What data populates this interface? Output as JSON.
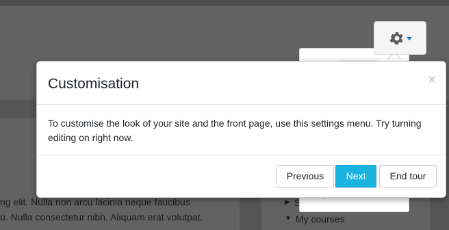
{
  "background": {
    "paragraph_line_1": "ng elit. Nulla non arcu lacinia neque faucibus",
    "paragraph_line_2": "u. Nulla consectetur nibh. Aliquam erat volutpat.",
    "nav_items": [
      {
        "label": "S"
      },
      {
        "label": "My courses"
      }
    ]
  },
  "settings_menu": {
    "icon": "gear-icon",
    "visible_item": "More..."
  },
  "tour": {
    "title": "Customisation",
    "body": "To customise the look of your site and the front page, use this settings menu. Try turning editing on right now.",
    "close_symbol": "×",
    "buttons": {
      "previous": "Previous",
      "next": "Next",
      "end": "End tour"
    }
  },
  "colors": {
    "next_button": "#1ab4e0",
    "cog_caret": "#1177d1"
  }
}
